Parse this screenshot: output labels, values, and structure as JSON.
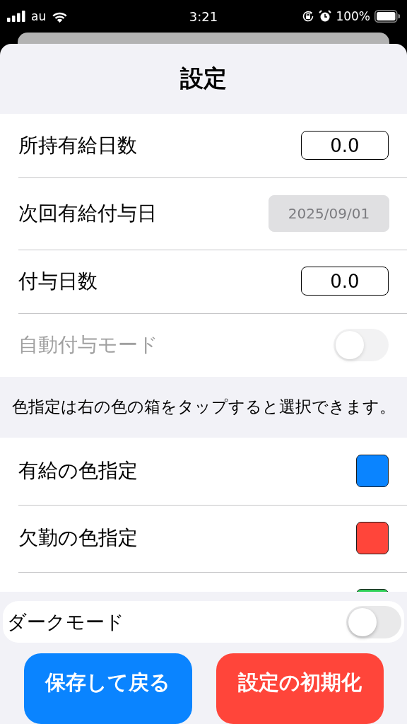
{
  "status_bar": {
    "carrier": "au",
    "time": "3:21",
    "battery": "100%"
  },
  "title": "設定",
  "settings": [
    {
      "kind": "number",
      "label": "所持有給日数",
      "value": "0.0",
      "disabled": false
    },
    {
      "kind": "date",
      "label": "次回有給付与日",
      "value": "2025/09/01",
      "disabled": true
    },
    {
      "kind": "number",
      "label": "付与日数",
      "value": "0.0",
      "disabled": false
    },
    {
      "kind": "toggle",
      "label": "自動付与モード",
      "on": false,
      "disabled": true
    }
  ],
  "note": "色指定は右の色の箱をタップすると選択できます。",
  "colors": [
    {
      "label": "有給の色指定",
      "color": "#0a84ff"
    },
    {
      "label": "欠勤の色指定",
      "color": "#ff453a"
    },
    {
      "color": "#30d158"
    }
  ],
  "dark_mode": {
    "label": "ダークモード",
    "on": false
  },
  "buttons": [
    {
      "label": "保存して戻る",
      "color": "#0a84ff"
    },
    {
      "label": "設定の初期化",
      "color": "#ff453a"
    }
  ]
}
